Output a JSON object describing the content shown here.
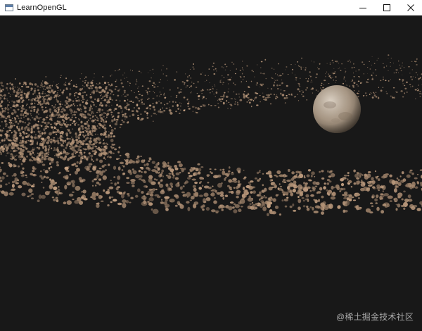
{
  "window": {
    "title": "LearnOpenGL",
    "icon": "app-window-icon",
    "controls": [
      "minimize-icon",
      "maximize-icon",
      "close-icon"
    ]
  },
  "scene": {
    "background_color": "#181818",
    "asteroid_color": "#a88a70",
    "planet_color": "#b5a592",
    "elements": [
      "asteroid-ring",
      "planet"
    ]
  },
  "watermark": {
    "text": "@稀土掘金技术社区"
  }
}
